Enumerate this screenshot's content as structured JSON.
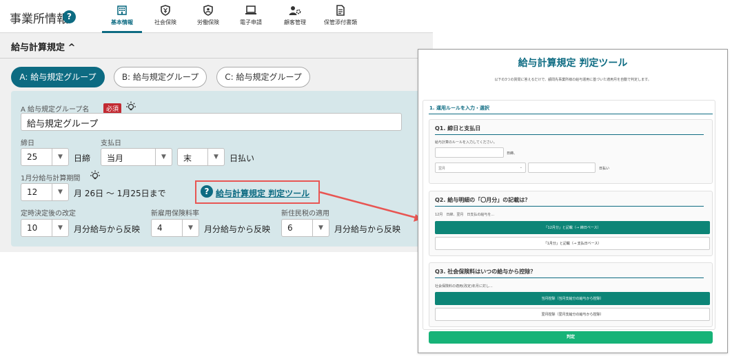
{
  "header": {
    "title": "事業所情報",
    "help_icon": "?",
    "tabs": [
      {
        "label": "基本情報",
        "icon": "building-icon",
        "active": true
      },
      {
        "label": "社会保険",
        "icon": "shield-yen-icon"
      },
      {
        "label": "労働保険",
        "icon": "shield-person-icon"
      },
      {
        "label": "電子申請",
        "icon": "laptop-icon"
      },
      {
        "label": "顧客管理",
        "icon": "user-gear-icon"
      },
      {
        "label": "保管添付書類",
        "icon": "document-icon"
      }
    ]
  },
  "section": {
    "title": "給与計算規定",
    "chevron": "^"
  },
  "groups": [
    {
      "label": "A: 給与規定グループ",
      "active": true
    },
    {
      "label": "B: 給与規定グループ"
    },
    {
      "label": "C: 給与規定グループ"
    }
  ],
  "form": {
    "group_name_label": "A 給与規定グループ名",
    "required": "必須",
    "group_name_value": "給与規定グループ",
    "shime_label": "締日",
    "shime_value": "25",
    "shime_suffix": "日締",
    "pay_label": "支払日",
    "pay_month": "当月",
    "pay_day": "末",
    "pay_suffix": "日払い",
    "period_label": "1月分給与計算期間",
    "period_month": "12",
    "period_text": "月 26日 〜 1月25日まで",
    "tool_link": "給与計算規定 判定ツール",
    "teiji_label": "定時決定後の改定",
    "teiji_value": "10",
    "teiji_suffix": "月分給与から反映",
    "koyo_label": "新雇用保険料率",
    "koyo_value": "4",
    "koyo_suffix": "月分給与から反映",
    "jumin_label": "新住民税の適用",
    "jumin_value": "6",
    "jumin_suffix": "月分給与から反映",
    "arrow": "▼"
  },
  "modal": {
    "title": "給与計算規定 判定ツール",
    "desc": "以下の3つの質問に答えるだけで、顧問先事業所様の給与運用に基づいた適用月を自動で判定します。",
    "section": "1. 運用ルールを入力・選択",
    "q1": {
      "title": "Q1. 締日と支払日",
      "desc": "給与計算のルールを入力してください。",
      "suffix1": "日締、",
      "select": "翌月",
      "suffix2": "日払い"
    },
    "q2": {
      "title": "Q2. 給与明細の「〇月分」の記載は？",
      "desc": "12月　日締、翌月　日支払の給与を...",
      "btn1": "「12月分」と記載（→ 締日ベース）",
      "btn2": "「1月分」と記載（→ 支払日ベース）"
    },
    "q3": {
      "title": "Q3. 社会保険料はいつの給与から控除？",
      "desc": "社会保険料の適用(改定)年月に対し...",
      "btn1": "当月控除（当月支給分の給与から控除）",
      "btn2": "翌月控除（翌月支給分の給与から控除）"
    },
    "judge": "判定"
  },
  "colors": {
    "accent": "#0d6b82",
    "highlight": "#e85552",
    "primary_btn": "#0d8577",
    "judge_btn": "#17b378"
  }
}
